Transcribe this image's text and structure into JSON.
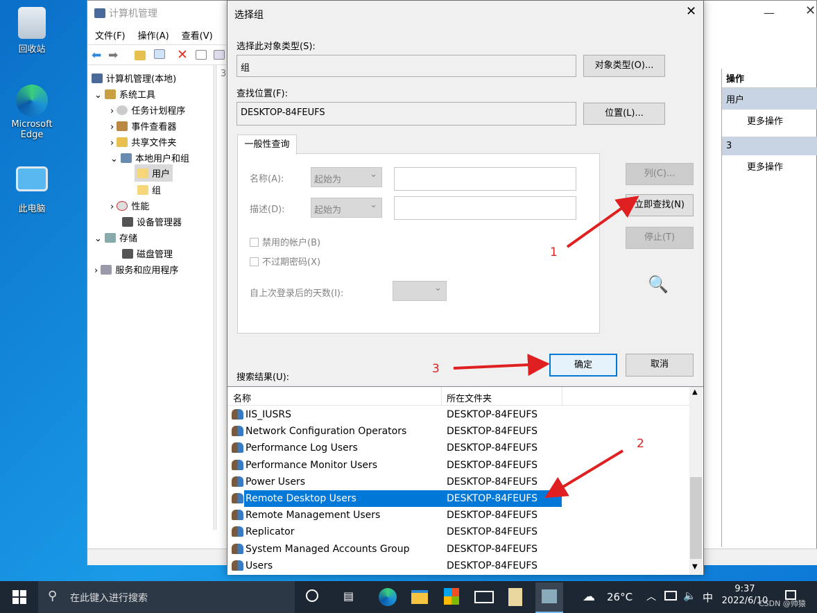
{
  "desktop": {
    "icons": [
      {
        "label": "回收站"
      },
      {
        "label": "Microsoft Edge"
      },
      {
        "label": "此电脑"
      }
    ]
  },
  "mmc": {
    "title": "计算机管理",
    "menu": [
      "文件(F)",
      "操作(A)",
      "查看(V)"
    ],
    "tree": [
      "计算机管理(本地)",
      "系统工具",
      "任务计划程序",
      "事件查看器",
      "共享文件夹",
      "本地用户和组",
      "用户",
      "组",
      "性能",
      "设备管理器",
      "存储",
      "磁盘管理",
      "服务和应用程序"
    ],
    "actions": {
      "header": "操作",
      "sec1": "用户",
      "more1": "更多操作",
      "sec2": "3",
      "more2": "更多操作"
    },
    "col_frag": "3"
  },
  "dialog": {
    "title": "选择组",
    "object_type_label": "选择此对象类型(S):",
    "object_type_value": "组",
    "object_type_btn": "对象类型(O)...",
    "location_label": "查找位置(F):",
    "location_value": "DESKTOP-84FEUFS",
    "location_btn": "位置(L)...",
    "tab": "一般性查询",
    "name_label": "名称(A):",
    "name_mode": "起始为",
    "desc_label": "描述(D):",
    "desc_mode": "起始为",
    "disabled_accounts": "禁用的帐户(B)",
    "no_expire": "不过期密码(X)",
    "days_label": "自上次登录后的天数(I):",
    "columns_btn": "列(C)...",
    "find_now_btn": "立即查找(N)",
    "stop_btn": "停止(T)",
    "ok_btn": "确定",
    "cancel_btn": "取消",
    "results_label": "搜索结果(U):",
    "col_name": "名称",
    "col_folder": "所在文件夹",
    "rows": [
      {
        "name": "IIS_IUSRS",
        "folder": "DESKTOP-84FEUFS"
      },
      {
        "name": "Network Configuration Operators",
        "folder": "DESKTOP-84FEUFS"
      },
      {
        "name": "Performance Log Users",
        "folder": "DESKTOP-84FEUFS"
      },
      {
        "name": "Performance Monitor Users",
        "folder": "DESKTOP-84FEUFS"
      },
      {
        "name": "Power Users",
        "folder": "DESKTOP-84FEUFS"
      },
      {
        "name": "Remote Desktop Users",
        "folder": "DESKTOP-84FEUFS",
        "selected": true
      },
      {
        "name": "Remote Management Users",
        "folder": "DESKTOP-84FEUFS"
      },
      {
        "name": "Replicator",
        "folder": "DESKTOP-84FEUFS"
      },
      {
        "name": "System Managed Accounts Group",
        "folder": "DESKTOP-84FEUFS"
      },
      {
        "name": "Users",
        "folder": "DESKTOP-84FEUFS"
      }
    ]
  },
  "annotations": {
    "a1": "1",
    "a2": "2",
    "a3": "3"
  },
  "taskbar": {
    "search_placeholder": "在此键入进行搜索",
    "weather": "26°C",
    "ime": "中",
    "time": "9:37",
    "date": "2022/6/10",
    "watermark": "CSDN @帅猿"
  }
}
